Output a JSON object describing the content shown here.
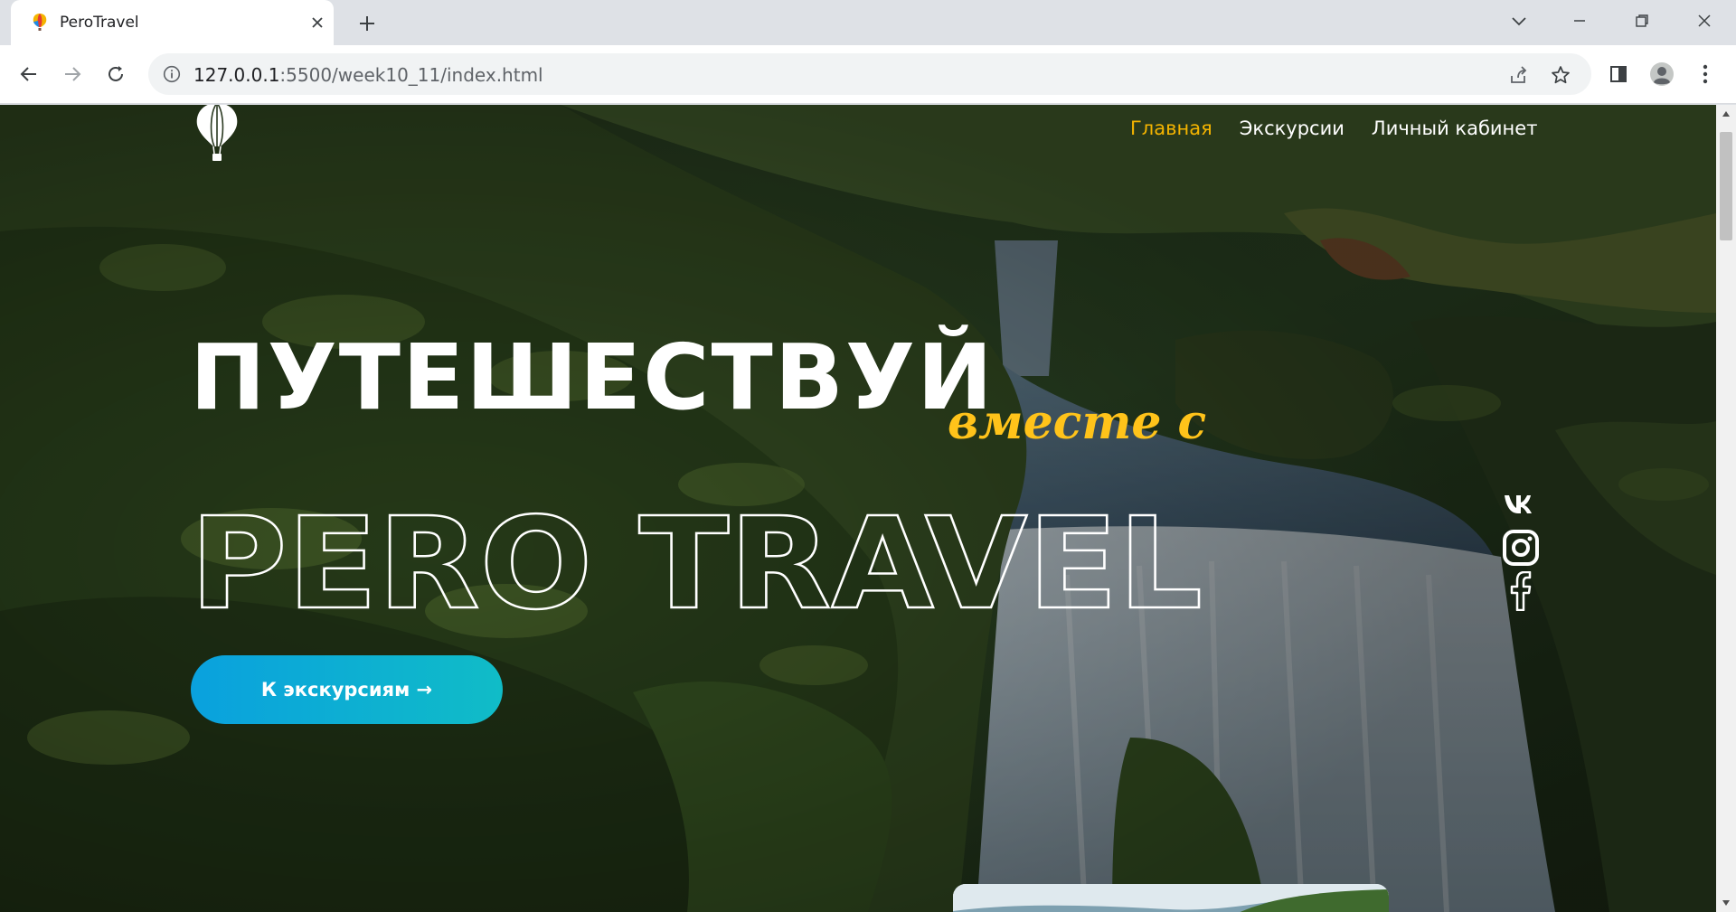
{
  "browser": {
    "tab_title": "PeroTravel",
    "url_host": "127.0.0.1",
    "url_rest": ":5500/week10_11/index.html"
  },
  "site": {
    "nav": [
      {
        "label": "Главная",
        "active": true
      },
      {
        "label": "Экскурсии",
        "active": false
      },
      {
        "label": "Личный кабинет",
        "active": false
      }
    ],
    "hero": {
      "title": "ПУТЕШЕСТВУЙ",
      "script": "вместе с",
      "brand": "PERO TRAVEL"
    },
    "cta_label": "К экскурсиям →",
    "social": [
      "vk-icon",
      "instagram-icon",
      "facebook-icon"
    ]
  },
  "colors": {
    "accent": "#f4b400",
    "script": "#ffc31a",
    "cta_start": "#0aa1de",
    "cta_end": "#10bcc7"
  }
}
